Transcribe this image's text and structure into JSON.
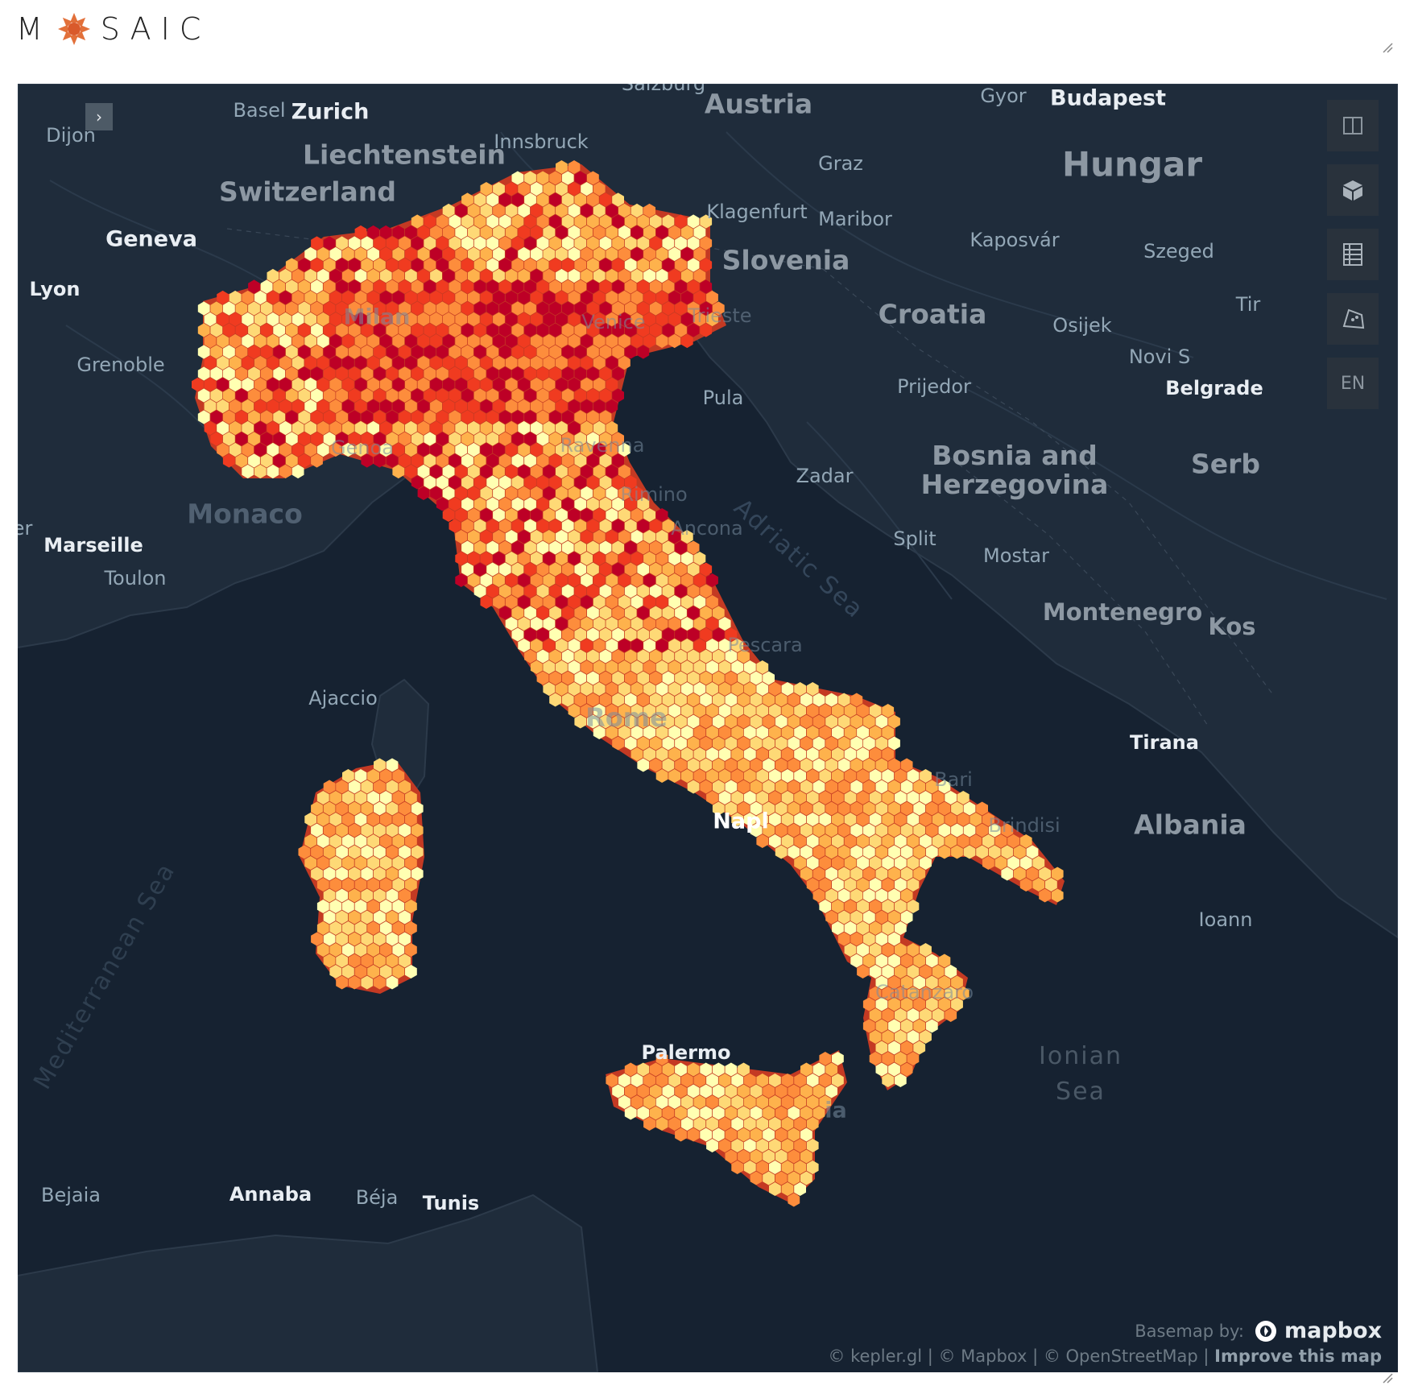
{
  "app": {
    "logo_pre": "M",
    "logo_post": "SAIC"
  },
  "map": {
    "colors": [
      "#ffffb2",
      "#fed976",
      "#feb24c",
      "#fd8d3c",
      "#f03b20",
      "#bd0026"
    ],
    "controls": {
      "split_icon": "split-map-icon",
      "view3d_icon": "3d-cube-icon",
      "legend_icon": "legend-icon",
      "draw_icon": "draw-polygon-icon",
      "locale": "EN"
    },
    "labels": {
      "salzburg": "Salzburg",
      "basel": "Basel",
      "zurich": "Zurich",
      "dijon": "Dijon",
      "liechtenstein": "Liechtenstein",
      "innsbruck": "Innsbruck",
      "austria": "Austria",
      "gyor": "Gyor",
      "budapest": "Budapest",
      "hungary": "Hungar",
      "graz": "Graz",
      "switzerland": "Switzerland",
      "klagenfurt": "Klagenfurt",
      "maribor": "Maribor",
      "kaposvar": "Kaposvár",
      "szeged": "Szeged",
      "geneva": "Geneva",
      "slovenia": "Slovenia",
      "lyon": "Lyon",
      "milan": "Milan",
      "venice": "Venice",
      "trieste": "Trieste",
      "croatia": "Croatia",
      "osijek": "Osijek",
      "tirana_top": "Tir",
      "novi_sad": "Novi S",
      "grenoble": "Grenoble",
      "pula": "Pula",
      "prijedor": "Prijedor",
      "belgrade": "Belgrade",
      "genoa": "Genoa",
      "ravenna": "Ravenna",
      "bosnia": "Bosnia and\nHerzegovina",
      "zadar": "Zadar",
      "serbia": "Serb",
      "monaco": "Monaco",
      "rimini": "Rimino",
      "ancona": "Ancona",
      "adriatic": "Adriatic Sea",
      "er": "er",
      "marseille": "Marseille",
      "split": "Split",
      "mostar": "Mostar",
      "toulon": "Toulon",
      "montenegro": "Montenegro",
      "kosovo": "Kos",
      "pescara": "Pescara",
      "ajaccio": "Ajaccio",
      "rome": "Rome",
      "tirana": "Tirana",
      "bari": "Bari",
      "naples": "Napl",
      "brindisi": "Brindisi",
      "albania": "Albania",
      "ioannina": "Ioann",
      "mediterranean": "Mediterranean Sea",
      "catanzaro": "Catanzaro",
      "palermo": "Palermo",
      "ionian": "Ionian\nSea",
      "catania": "ia",
      "bejaia": "Bejaia",
      "annaba": "Annaba",
      "beja": "Béja",
      "tunis": "Tunis"
    },
    "basemap_by": "Basemap by:",
    "mapbox": "mapbox",
    "attribution": "© kepler.gl | © Mapbox | © OpenStreetMap | ",
    "improve": "Improve this map"
  }
}
